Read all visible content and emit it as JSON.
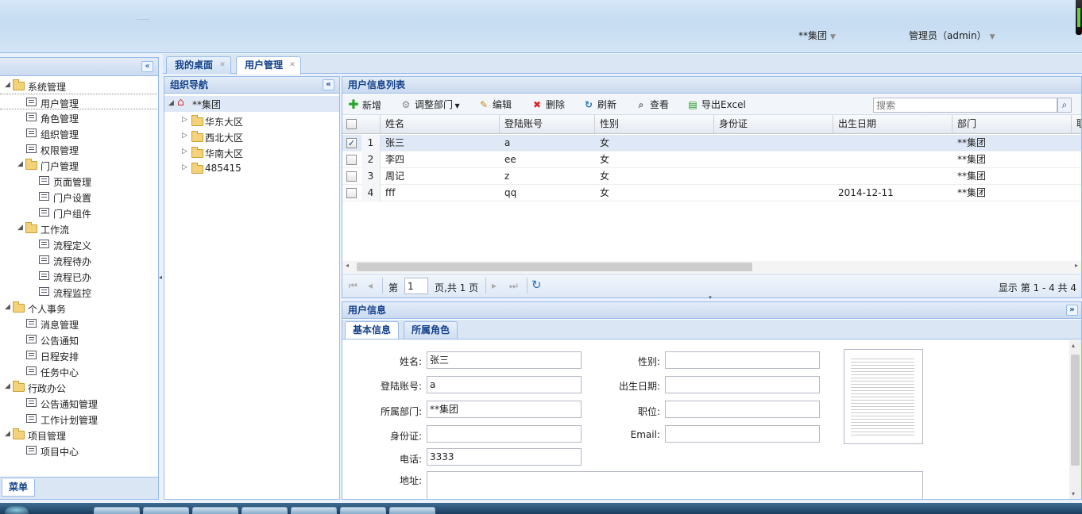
{
  "header": {
    "org": "**集团",
    "user": "管理员（admin）"
  },
  "sidebar": {
    "collapse_icon": "«",
    "footer_tab": "菜单",
    "items": [
      {
        "label": "系统管理",
        "level": 0,
        "type": "folder"
      },
      {
        "label": "用户管理",
        "level": 1,
        "type": "doc"
      },
      {
        "label": "角色管理",
        "level": 1,
        "type": "doc"
      },
      {
        "label": "组织管理",
        "level": 1,
        "type": "doc"
      },
      {
        "label": "权限管理",
        "level": 1,
        "type": "doc"
      },
      {
        "label": "门户管理",
        "level": 1,
        "type": "folder"
      },
      {
        "label": "页面管理",
        "level": 2,
        "type": "doc"
      },
      {
        "label": "门户设置",
        "level": 2,
        "type": "doc"
      },
      {
        "label": "门户组件",
        "level": 2,
        "type": "doc"
      },
      {
        "label": "工作流",
        "level": 1,
        "type": "folder"
      },
      {
        "label": "流程定义",
        "level": 2,
        "type": "doc"
      },
      {
        "label": "流程待办",
        "level": 2,
        "type": "doc"
      },
      {
        "label": "流程已办",
        "level": 2,
        "type": "doc"
      },
      {
        "label": "流程监控",
        "level": 2,
        "type": "doc"
      },
      {
        "label": "个人事务",
        "level": 0,
        "type": "folder"
      },
      {
        "label": "消息管理",
        "level": 1,
        "type": "doc"
      },
      {
        "label": "公告通知",
        "level": 1,
        "type": "doc"
      },
      {
        "label": "日程安排",
        "level": 1,
        "type": "doc"
      },
      {
        "label": "任务中心",
        "level": 1,
        "type": "doc"
      },
      {
        "label": "行政办公",
        "level": 0,
        "type": "folder"
      },
      {
        "label": "公告通知管理",
        "level": 1,
        "type": "doc"
      },
      {
        "label": "工作计划管理",
        "level": 1,
        "type": "doc"
      },
      {
        "label": "项目管理",
        "level": 0,
        "type": "folder"
      },
      {
        "label": "项目中心",
        "level": 1,
        "type": "doc"
      }
    ]
  },
  "tabs": [
    {
      "label": "我的桌面",
      "active": false
    },
    {
      "label": "用户管理",
      "active": true
    }
  ],
  "org_nav": {
    "title": "组织导航",
    "root": "**集团",
    "children": [
      "华东大区",
      "西北大区",
      "华南大区",
      "485415"
    ]
  },
  "user_list": {
    "title": "用户信息列表",
    "toolbar": {
      "add": "新增",
      "adjust": "调整部门",
      "edit": "编辑",
      "delete": "删除",
      "refresh": "刷新",
      "view": "查看",
      "export": "导出Excel",
      "search_placeholder": "搜索"
    },
    "columns": [
      "姓名",
      "登陆账号",
      "性别",
      "身份证",
      "出生日期",
      "部门",
      "职"
    ],
    "rows": [
      {
        "no": "1",
        "name": "张三",
        "account": "a",
        "gender": "女",
        "id": "",
        "birth": "",
        "dept": "**集团",
        "checked": true
      },
      {
        "no": "2",
        "name": "李四",
        "account": "ee",
        "gender": "女",
        "id": "",
        "birth": "",
        "dept": "**集团",
        "checked": false
      },
      {
        "no": "3",
        "name": "周记",
        "account": "z",
        "gender": "女",
        "id": "",
        "birth": "",
        "dept": "**集团",
        "checked": false
      },
      {
        "no": "4",
        "name": "fff",
        "account": "qq",
        "gender": "女",
        "id": "",
        "birth": "2014-12-11",
        "dept": "**集团",
        "checked": false
      }
    ],
    "pager": {
      "before": "第",
      "page": "1",
      "after": "页,共 1 页",
      "summary": "显示 第 1 - 4 共 4"
    }
  },
  "user_info": {
    "title": "用户信息",
    "tabs": [
      "基本信息",
      "所属角色"
    ],
    "labels": {
      "name": "姓名:",
      "account": "登陆账号:",
      "dept": "所属部门:",
      "idcard": "身份证:",
      "phone": "电话:",
      "address": "地址:",
      "gender": "性别:",
      "birth": "出生日期:",
      "position": "职位:",
      "email": "Email:"
    },
    "values": {
      "name": "张三",
      "account": "a",
      "dept": "**集团",
      "idcard": "",
      "phone": "3333",
      "address": "",
      "gender": "",
      "birth": "",
      "position": "",
      "email": ""
    }
  }
}
